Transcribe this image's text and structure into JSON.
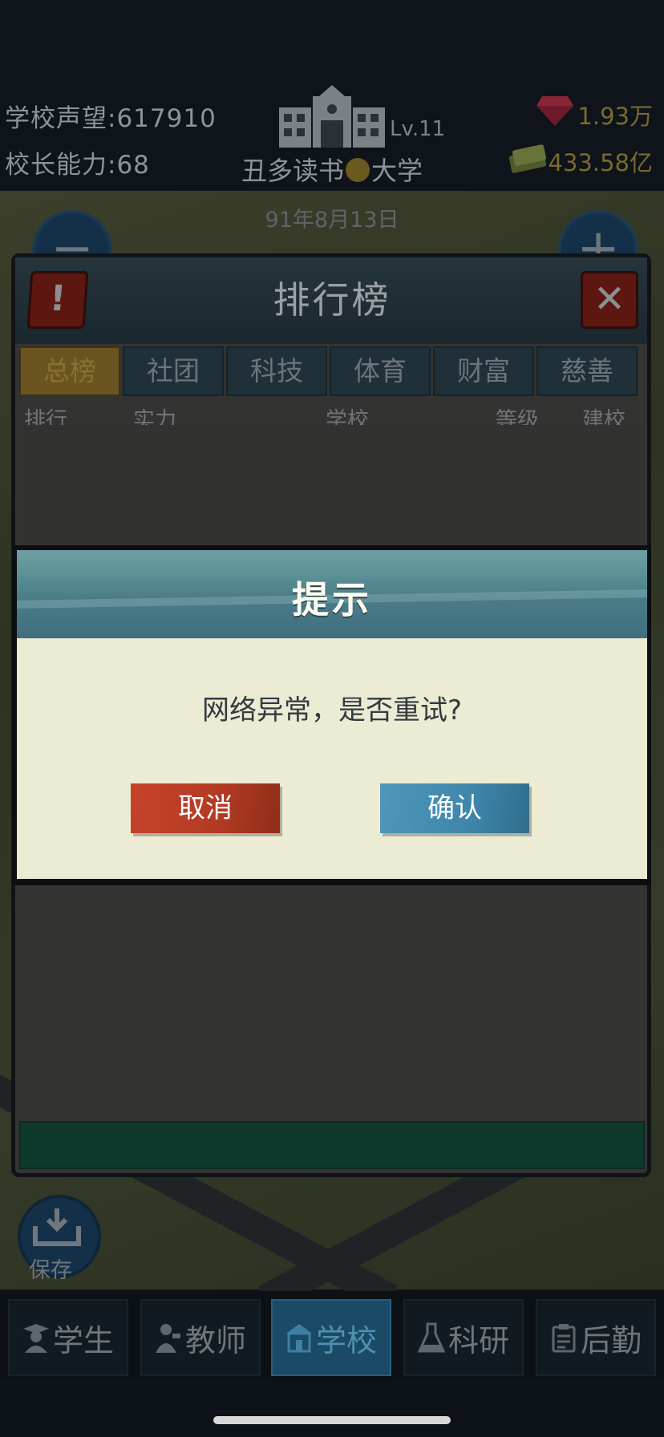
{
  "status": {
    "reputation_label": "学校声望:",
    "reputation_value": "617910",
    "ability_label": "校长能力:",
    "ability_value": "68",
    "level": "Lv.11",
    "school_name_part1": "丑多读书",
    "school_name_part2": "大学",
    "gems": "1.93万",
    "money": "433.58亿",
    "date": "91年8月13日"
  },
  "leaderboard": {
    "title": "排行榜",
    "tabs": [
      {
        "label": "总榜",
        "active": true
      },
      {
        "label": "社团",
        "active": false
      },
      {
        "label": "科技",
        "active": false
      },
      {
        "label": "体育",
        "active": false
      },
      {
        "label": "财富",
        "active": false
      },
      {
        "label": "慈善",
        "active": false
      }
    ],
    "columns": [
      "排行",
      "实力",
      "学校",
      "等级",
      "建校"
    ]
  },
  "dialog": {
    "title": "提示",
    "message": "网络异常，是否重试?",
    "cancel_label": "取消",
    "confirm_label": "确认"
  },
  "save": {
    "label": "保存"
  },
  "nav": {
    "items": [
      {
        "label": "学生",
        "icon": "student-icon"
      },
      {
        "label": "教师",
        "icon": "teacher-icon"
      },
      {
        "label": "学校",
        "icon": "school-icon",
        "active": true
      },
      {
        "label": "科研",
        "icon": "flask-icon"
      },
      {
        "label": "后勤",
        "icon": "clipboard-icon"
      }
    ]
  },
  "colors": {
    "dialog_header": "#4a7c88",
    "dialog_body": "#ecebd3",
    "cancel_button": "#b23a22",
    "confirm_button": "#3f86ab"
  }
}
